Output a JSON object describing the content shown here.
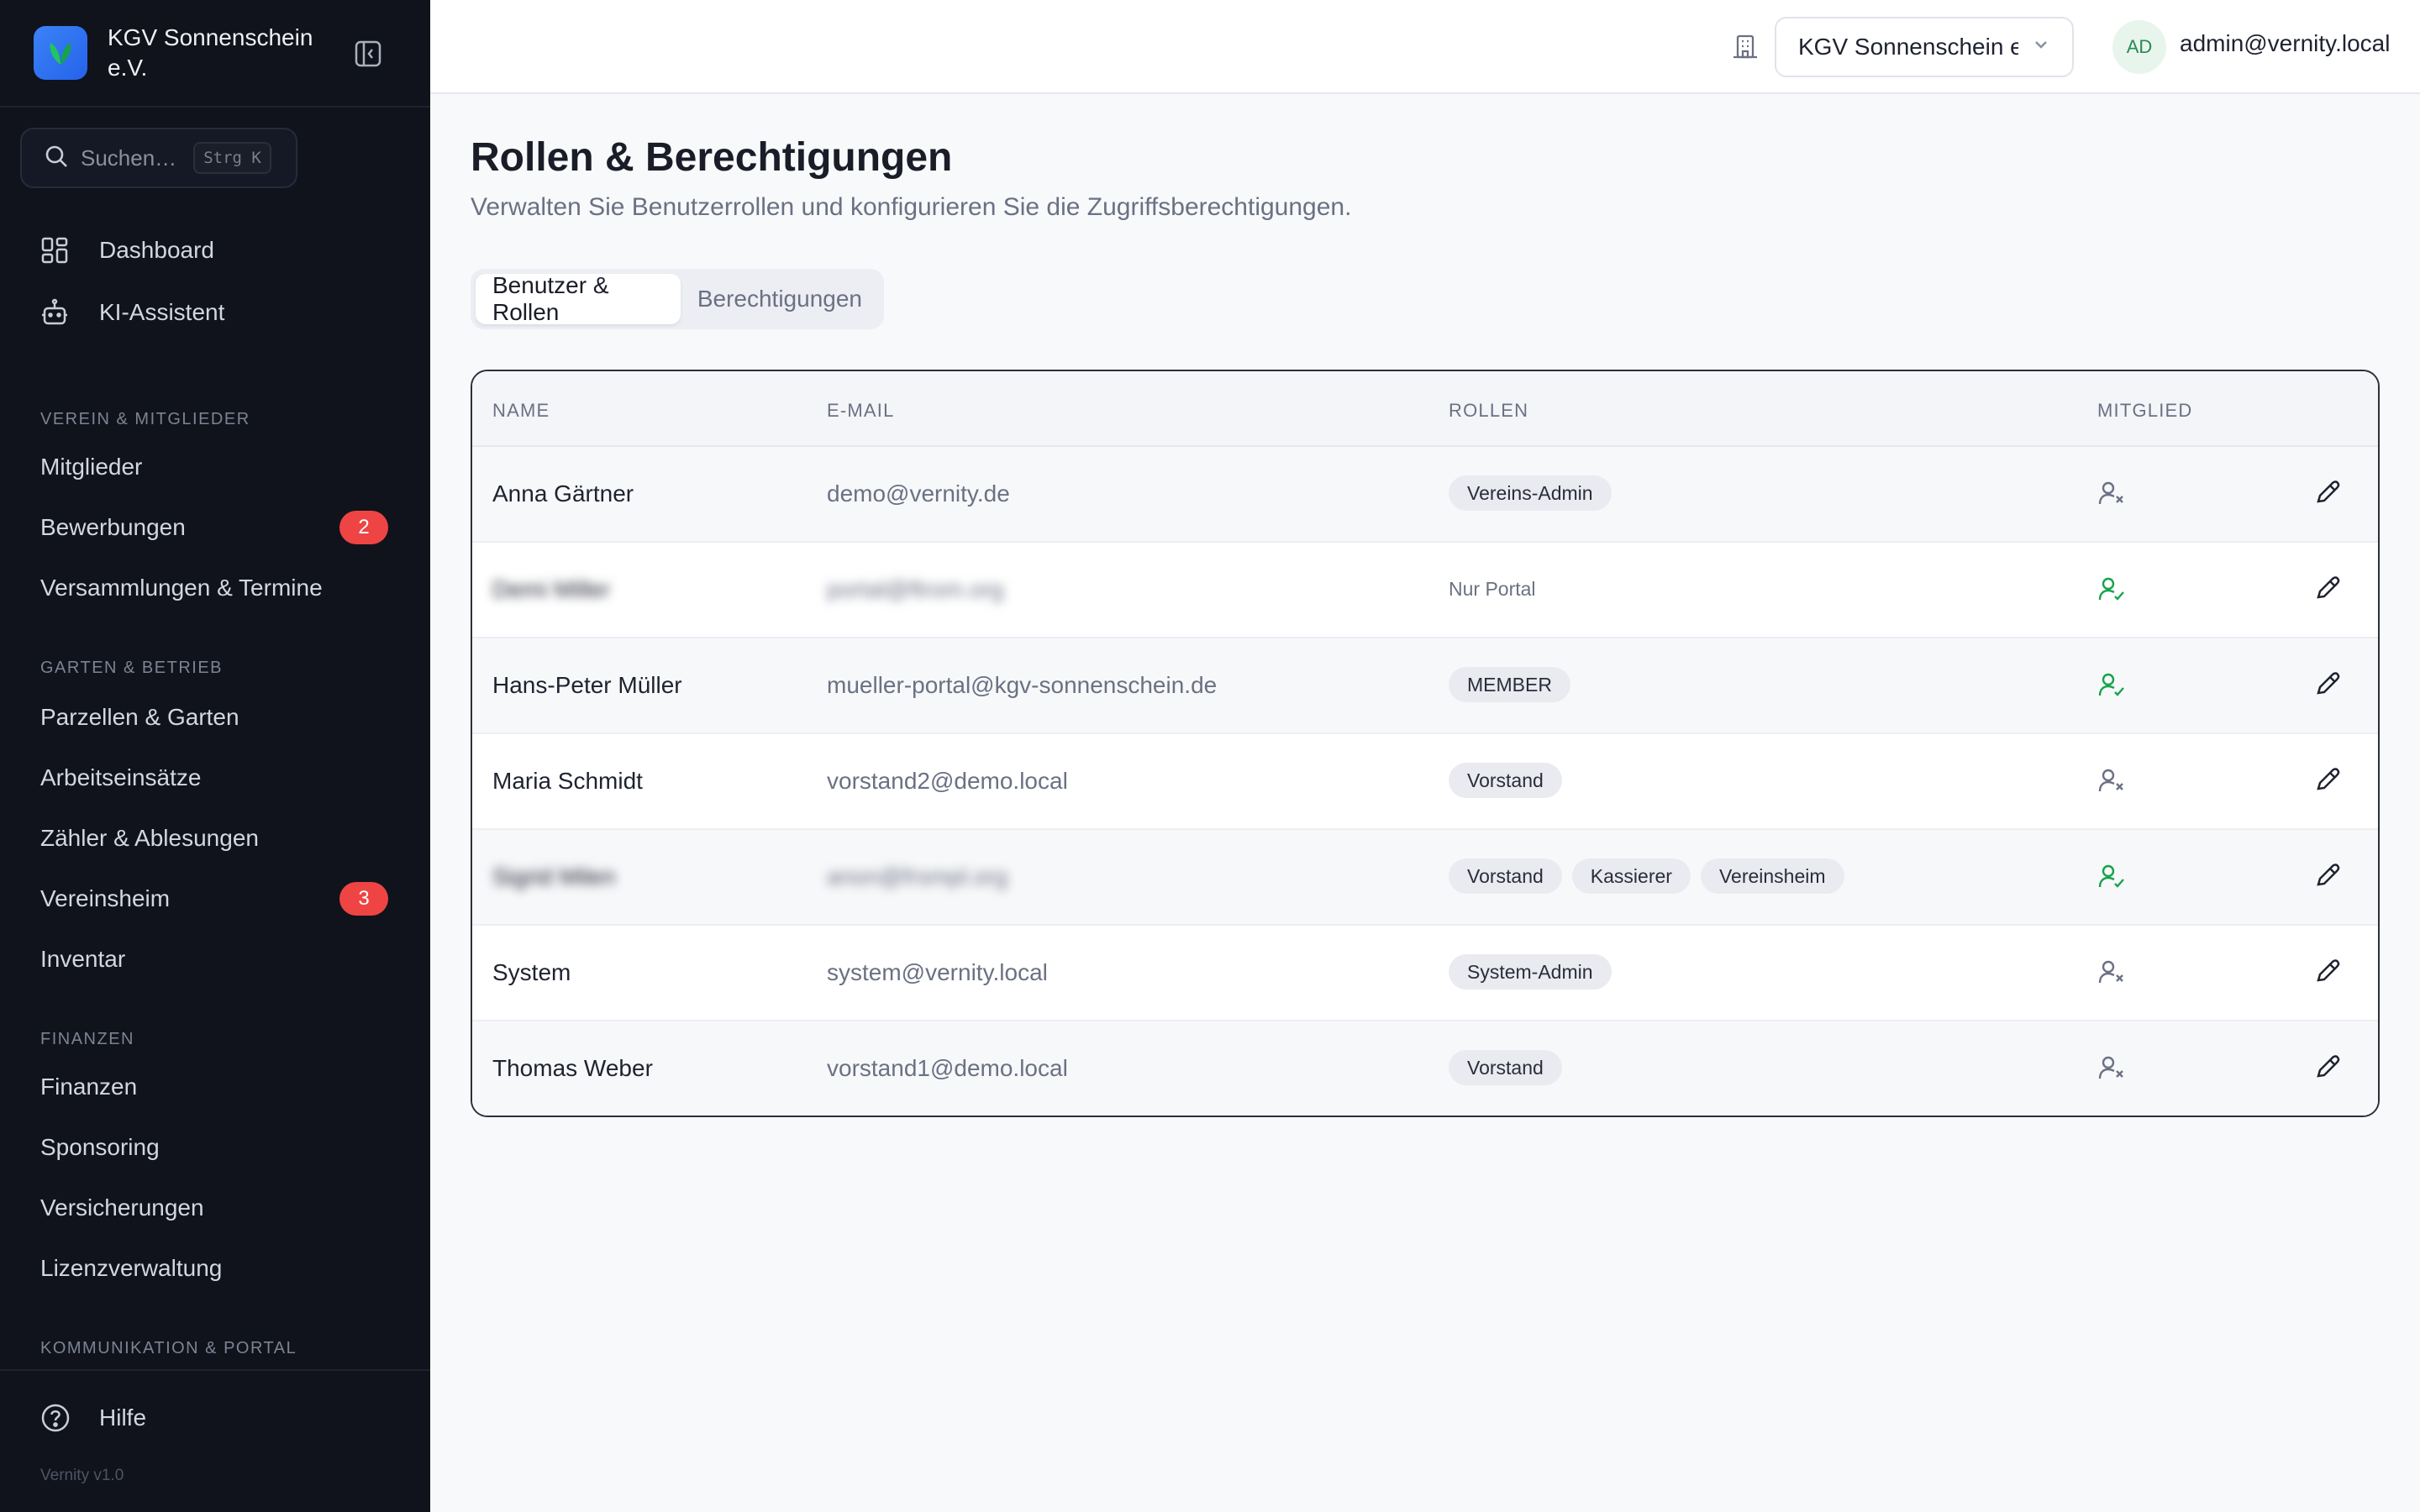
{
  "brand": {
    "name": "KGV Sonnenschein e.V."
  },
  "search": {
    "placeholder": "Suchen…",
    "shortcut": "Strg K"
  },
  "nav_top": [
    {
      "label": "Dashboard",
      "icon": "dashboard-icon"
    },
    {
      "label": "KI-Assistent",
      "icon": "robot-icon"
    }
  ],
  "sections": [
    {
      "title": "VEREIN & MITGLIEDER",
      "items": [
        {
          "label": "Mitglieder"
        },
        {
          "label": "Bewerbungen",
          "badge": "2"
        },
        {
          "label": "Versammlungen & Termine"
        }
      ]
    },
    {
      "title": "GARTEN & BETRIEB",
      "items": [
        {
          "label": "Parzellen & Garten"
        },
        {
          "label": "Arbeitseinsätze"
        },
        {
          "label": "Zähler & Ablesungen"
        },
        {
          "label": "Vereinsheim",
          "badge": "3"
        },
        {
          "label": "Inventar"
        }
      ]
    },
    {
      "title": "FINANZEN",
      "items": [
        {
          "label": "Finanzen"
        },
        {
          "label": "Sponsoring"
        },
        {
          "label": "Versicherungen"
        },
        {
          "label": "Lizenzverwaltung"
        }
      ]
    },
    {
      "title": "KOMMUNIKATION & PORTAL",
      "items": []
    }
  ],
  "footer": {
    "help_label": "Hilfe",
    "version": "Vernity v1.0"
  },
  "topbar": {
    "org_value": "KGV Sonnenschein e.V.",
    "avatar_initials": "AD",
    "user_email": "admin@vernity.local"
  },
  "page": {
    "title": "Rollen & Berechtigungen",
    "subtitle": "Verwalten Sie Benutzerrollen und konfigurieren Sie die Zugriffsberechtigungen.",
    "tabs": [
      "Benutzer & Rollen",
      "Berechtigungen"
    ]
  },
  "table": {
    "headers": [
      "NAME",
      "E-MAIL",
      "ROLLEN",
      "MITGLIED"
    ],
    "rows": [
      {
        "name": "Anna Gärtner",
        "email": "demo@vernity.de",
        "roles": [
          "Vereins-Admin"
        ],
        "member": false
      },
      {
        "name": "Demi Miller",
        "email": "portal@ftrom.org",
        "roles": [],
        "plain_role": "Nur Portal",
        "member": true,
        "blurred": true
      },
      {
        "name": "Hans-Peter Müller",
        "email": "mueller-portal@kgv-sonnenschein.de",
        "roles": [
          "MEMBER"
        ],
        "member": true
      },
      {
        "name": "Maria Schmidt",
        "email": "vorstand2@demo.local",
        "roles": [
          "Vorstand"
        ],
        "member": false
      },
      {
        "name": "Sigrid Milen",
        "email": "anon@frsmpl.org",
        "roles": [
          "Vorstand",
          "Kassierer",
          "Vereinsheim"
        ],
        "member": true,
        "blurred": true
      },
      {
        "name": "System",
        "email": "system@vernity.local",
        "roles": [
          "System-Admin"
        ],
        "member": false
      },
      {
        "name": "Thomas Weber",
        "email": "vorstand1@demo.local",
        "roles": [
          "Vorstand"
        ],
        "member": false
      }
    ]
  },
  "colors": {
    "sidebar": "#10131b",
    "accent": "#3b82f6",
    "badge": "#ef4444",
    "member_yes": "#16a34a",
    "member_no": "#6b7183"
  }
}
